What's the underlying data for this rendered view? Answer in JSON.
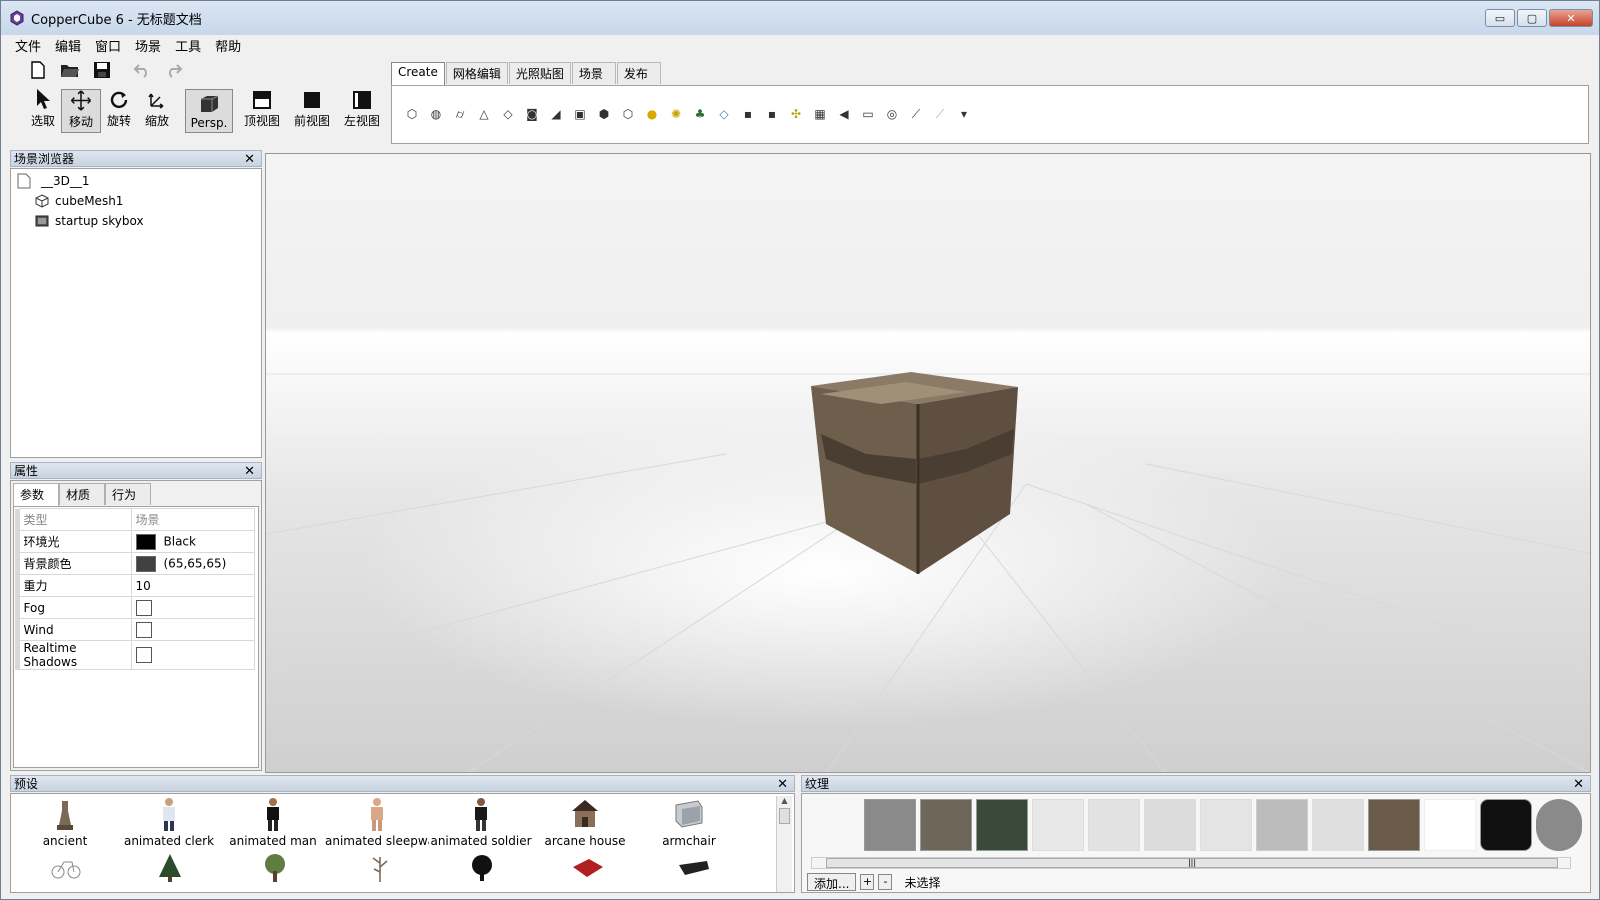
{
  "window": {
    "title": "CopperCube 6 - 无标题文档",
    "min": "▭",
    "max": "▢",
    "close": "✕"
  },
  "menu": [
    "文件",
    "编辑",
    "窗口",
    "场景",
    "工具",
    "帮助"
  ],
  "toolbar": {
    "tools": [
      {
        "label": "选取",
        "icon": "arrow-pointer-icon"
      },
      {
        "label": "移动",
        "icon": "move-arrows-icon"
      },
      {
        "label": "旋转",
        "icon": "rotate-icon"
      },
      {
        "label": "缩放",
        "icon": "scale-icon"
      }
    ],
    "views": [
      {
        "label": "Persp.",
        "icon": "perspective-view-icon"
      },
      {
        "label": "顶视图",
        "icon": "top-view-icon"
      },
      {
        "label": "前视图",
        "icon": "front-view-icon"
      },
      {
        "label": "左视图",
        "icon": "left-view-icon"
      }
    ],
    "active_tool": "移动",
    "active_view": "Persp."
  },
  "create_tabs": [
    "Create",
    "网格编辑",
    "光照贴图",
    "场景",
    "发布"
  ],
  "create_icons": [
    "cube-icon",
    "sphere-icon",
    "cylinder-icon",
    "cone-icon",
    "plane-icon",
    "camera-icon",
    "terrain-icon",
    "billboard-icon",
    "mesh-icon",
    "box-icon",
    "light-icon",
    "particles-icon",
    "tree-icon",
    "water-icon",
    "b-icon",
    "b2-icon",
    "path-icon",
    "skybox-icon",
    "sound-icon",
    "2d-overlay-icon",
    "3d-text-icon",
    "line-icon",
    "path-node-icon",
    "more-dropdown-icon"
  ],
  "scene_browser": {
    "title": "场景浏览器",
    "nodes": [
      {
        "label": "__3D__1",
        "icon": "document-icon",
        "level": 0
      },
      {
        "label": "cubeMesh1",
        "icon": "cube-node-icon",
        "level": 1
      },
      {
        "label": "startup skybox",
        "icon": "skybox-node-icon",
        "level": 1
      }
    ]
  },
  "properties": {
    "title": "属性",
    "tabs": [
      "参数",
      "材质",
      "行为"
    ],
    "rows": [
      {
        "name": "类型",
        "value": "场景",
        "kind": "header"
      },
      {
        "name": "环境光",
        "value": "Black",
        "kind": "color",
        "color": "#000000"
      },
      {
        "name": "背景颜色",
        "value": "(65,65,65)",
        "kind": "color",
        "color": "#414141"
      },
      {
        "name": "重力",
        "value": "10",
        "kind": "text"
      },
      {
        "name": "Fog",
        "value": "",
        "kind": "check"
      },
      {
        "name": "Wind",
        "value": "",
        "kind": "check"
      },
      {
        "name": "Realtime Shadows",
        "value": "",
        "kind": "check"
      }
    ]
  },
  "presets": {
    "title": "预设",
    "items": [
      "ancient",
      "animated clerk",
      "animated man",
      "animated sleepwalker",
      "animated soldier",
      "arcane house",
      "armchair"
    ]
  },
  "textures": {
    "title": "纹理",
    "add_label": "添加...",
    "plus": "+",
    "minus": "-",
    "status": "未选择",
    "scroll_mark": "|||"
  }
}
